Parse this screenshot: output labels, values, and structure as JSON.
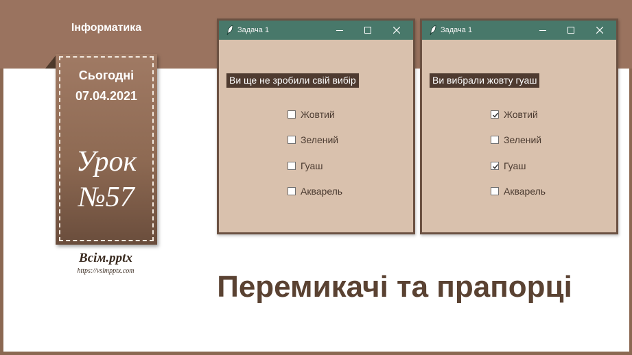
{
  "slide": {
    "subject": "Інформатика",
    "today_label": "Сьогодні",
    "date": "07.04.2021",
    "lesson_word": "Урок",
    "lesson_number": "№57",
    "brand": "Всім.pptx",
    "brand_url": "https://vsimpptx.com",
    "title": "Перемикачі та прапорці"
  },
  "windows": [
    {
      "title": "Задача 1",
      "status": "Ви ще не зробили свій вибір",
      "options": [
        {
          "label": "Жовтий",
          "checked": false
        },
        {
          "label": "Зелений",
          "checked": false
        },
        {
          "label": "Гуаш",
          "checked": false
        },
        {
          "label": "Акварель",
          "checked": false
        }
      ]
    },
    {
      "title": "Задача 1",
      "status": "Ви вибрали жовту гуаш",
      "options": [
        {
          "label": "Жовтий",
          "checked": true
        },
        {
          "label": "Зелений",
          "checked": false
        },
        {
          "label": "Гуаш",
          "checked": true
        },
        {
          "label": "Акварель",
          "checked": false
        }
      ]
    }
  ],
  "colors": {
    "band": "#9a735f",
    "titlebar": "#48786a",
    "window_bg": "#d9c1ad",
    "status_bg": "#4f3b30",
    "title_text": "#5a4232"
  }
}
